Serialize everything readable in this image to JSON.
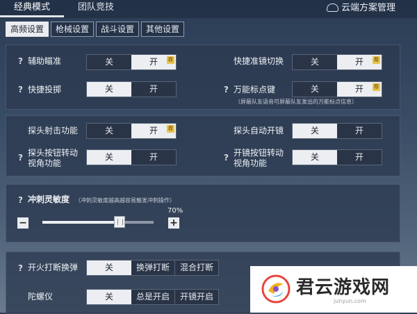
{
  "mode_tabs": [
    {
      "label": "经典模式",
      "active": true
    },
    {
      "label": "团队竞技",
      "active": false
    }
  ],
  "cloud_label": "云端方案管理",
  "sub_tabs": [
    {
      "label": "高频设置",
      "active": true
    },
    {
      "label": "枪械设置",
      "active": false
    },
    {
      "label": "战斗设置",
      "active": false
    },
    {
      "label": "其他设置",
      "active": false
    }
  ],
  "help_glyph": "?",
  "rec_badge": "荐",
  "off": "关",
  "on": "开",
  "panel1": {
    "assist_aim": "辅助瞄准",
    "quick_scope": "快捷准镜切换",
    "quick_throw": "快捷投掷",
    "marker_key": "万能标点键",
    "marker_note": "（屏蔽队友语音可屏蔽队友发出的万能标点信息）"
  },
  "panel2": {
    "peek_fire": "探头射击功能",
    "peek_auto_scope": "探头自动开镜",
    "peek_rotate_line1": "探头按钮转动",
    "peek_rotate_line2": "视角功能",
    "scope_rotate_line1": "开镜按钮转动",
    "scope_rotate_line2": "视角功能"
  },
  "panel3": {
    "sprint_label": "冲刺灵敏度",
    "sprint_note": "（冲刺灵敏度越高越容易触发冲刺操作）",
    "value_text": "70%",
    "value": 0.7,
    "minus": "−",
    "plus": "+"
  },
  "panel4": {
    "fire_interrupt": "开火打断换弹",
    "opt_reload_interrupt": "换弹打断",
    "opt_mixed_interrupt": "混合打断",
    "gyro": "陀螺仪",
    "opt_always_on": "总是开启",
    "opt_scope_on": "开镜开启"
  },
  "watermark": {
    "title": "君云游戏网",
    "sub": "junyun.com"
  }
}
